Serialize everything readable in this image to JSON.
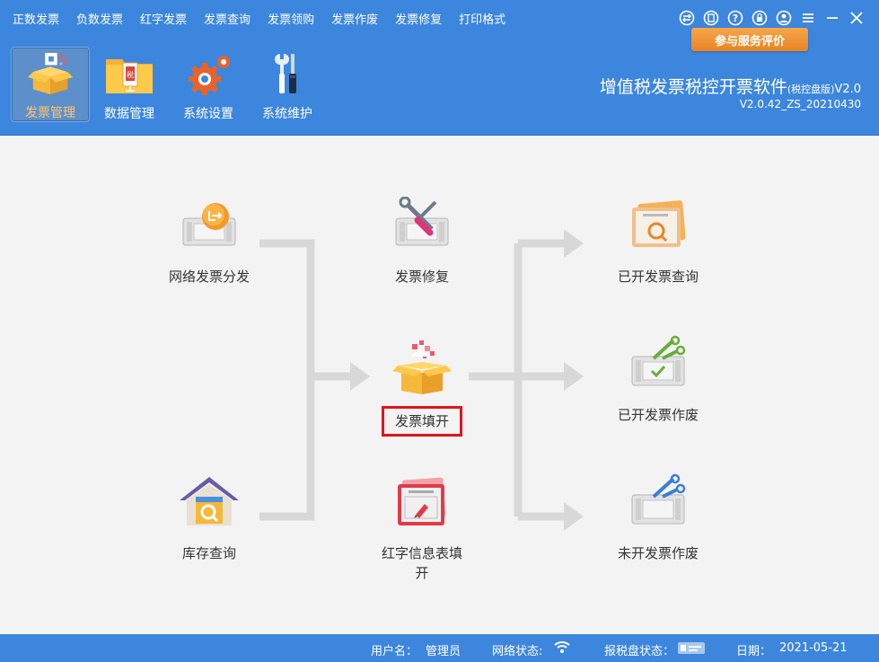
{
  "menu": {
    "items": [
      "正数发票",
      "负数发票",
      "红字发票",
      "发票查询",
      "发票领购",
      "发票作废",
      "发票修复",
      "打印格式"
    ]
  },
  "window_controls": [
    "switch-icon",
    "copy-icon",
    "help-icon",
    "lock-icon",
    "user-icon",
    "menu-icon",
    "minimize-icon",
    "close-icon"
  ],
  "feedback_button": "参与服务评价",
  "toolbar": {
    "items": [
      {
        "label": "发票管理",
        "icon": "invoice-box-icon",
        "active": true
      },
      {
        "label": "数据管理",
        "icon": "data-folder-icon",
        "active": false
      },
      {
        "label": "系统设置",
        "icon": "gears-icon",
        "active": false
      },
      {
        "label": "系统维护",
        "icon": "tools-icon",
        "active": false
      }
    ]
  },
  "app": {
    "title_main": "增值税发票税控开票软件",
    "title_small": "(税控盘版)",
    "title_suffix": "V2.0",
    "version": "V2.0.42_ZS_20210430"
  },
  "flow": {
    "network_dispatch": "网络发票分发",
    "invoice_repair": "发票修复",
    "invoice_fill": "发票填开",
    "red_info_form": "红字信息表填开",
    "inventory_query": "库存查询",
    "issued_query": "已开发票查询",
    "issued_void": "已开发票作废",
    "unissued_void": "未开发票作废"
  },
  "status": {
    "user_label": "用户名：",
    "user_value": "管理员",
    "network_label": "网络状态:",
    "tax_disk_label": "报税盘状态：",
    "date_label": "日期：",
    "date_value": "2021-05-21"
  },
  "colors": {
    "header_blue": "#3d86de",
    "accent_orange": "#e88424",
    "highlight_red": "#e0141c",
    "flow_line": "#d8d8d8"
  }
}
